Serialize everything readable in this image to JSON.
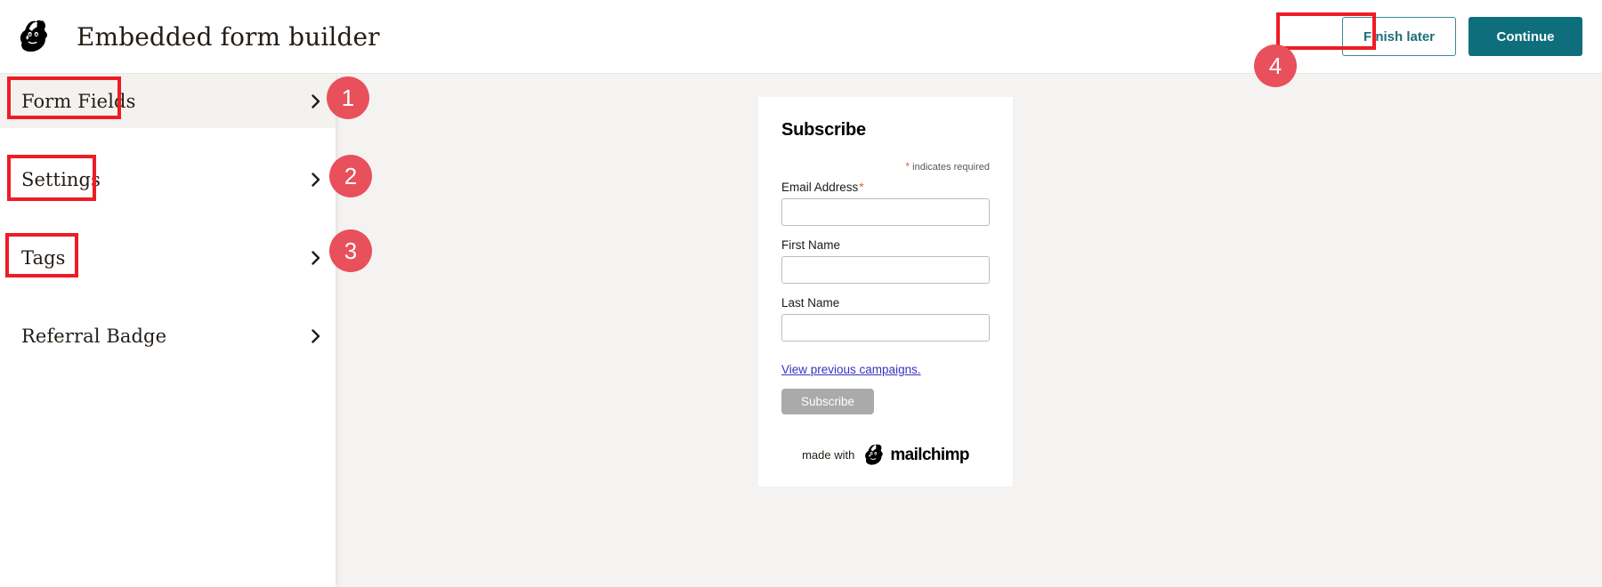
{
  "header": {
    "logo_icon": "mailchimp-freddie-icon",
    "title": "Embedded form builder",
    "finish_later_label": "Finish later",
    "continue_label": "Continue"
  },
  "sidebar": {
    "items": [
      {
        "label": "Form Fields",
        "chevron_icon": "chevron-right-icon",
        "active": true
      },
      {
        "label": "Settings",
        "chevron_icon": "chevron-right-icon",
        "active": false
      },
      {
        "label": "Tags",
        "chevron_icon": "chevron-right-icon",
        "active": false
      },
      {
        "label": "Referral Badge",
        "chevron_icon": "chevron-right-icon",
        "active": false
      }
    ]
  },
  "form_preview": {
    "title": "Subscribe",
    "required_star": "*",
    "required_note": "indicates required",
    "fields": [
      {
        "label": "Email Address",
        "required": true,
        "required_star": "*",
        "value": "",
        "placeholder": ""
      },
      {
        "label": "First Name",
        "required": false,
        "required_star": "",
        "value": "",
        "placeholder": ""
      },
      {
        "label": "Last Name",
        "required": false,
        "required_star": "",
        "value": "",
        "placeholder": ""
      }
    ],
    "previous_campaigns_link": "View previous campaigns.",
    "submit_label": "Subscribe",
    "footer_made_with": "made with",
    "footer_wordmark": "mailchimp",
    "footer_logo_icon": "mailchimp-freddie-icon"
  },
  "annotations": {
    "badges": [
      {
        "number": "1"
      },
      {
        "number": "2"
      },
      {
        "number": "3"
      },
      {
        "number": "4"
      }
    ],
    "box_color": "#EE1C25",
    "badge_color": "#E8505B"
  },
  "colors": {
    "teal_primary": "#0F6E7C",
    "teal_border": "#3D8A91",
    "canvas_bg": "#F4F3F1",
    "active_row_bg": "#F4F2EF",
    "required_star": "#E85C41",
    "link": "#3B2FBF",
    "submit_disabled": "#AAAAAA"
  }
}
